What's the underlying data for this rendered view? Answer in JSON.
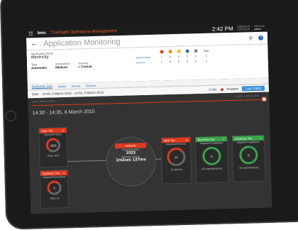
{
  "topbar": {
    "brand": "bmc",
    "app_title": "TrueSight Operations Management",
    "time": "2:42 PM",
    "date_line1": "03/06/2015",
    "date_line2": "GMT-08:00",
    "user_line1": "Welcome",
    "user_line2": "admin"
  },
  "header": {
    "title": "Application Monitoring"
  },
  "info": {
    "name_label": "Application Name",
    "name_value": "electricity",
    "type_label": "Type",
    "type_value": "Automatic",
    "importance_label": "Importance",
    "importance_value": "Medium",
    "severity_label": "Severity",
    "severity_value": "Critical",
    "total_label": "Total",
    "open_events_label": "Open Events",
    "devices_label": "Devices",
    "open_events": [
      "1",
      "0",
      "0",
      "0",
      "0",
      "1"
    ],
    "devices": [
      "1",
      "0",
      "0",
      "0",
      "0",
      "1"
    ],
    "severity_colors": [
      "#e03a1e",
      "#f08c1e",
      "#f0c01e",
      "#2a6db5",
      "#888888"
    ]
  },
  "tabs": [
    "Application View",
    "Model",
    "Events",
    "Devices"
  ],
  "datebar": {
    "date_label": "Date",
    "date_range": "14:40, 5 March 2015 - 14:55, 6 March 2015",
    "interval": "5 min",
    "problem": "Problem",
    "live_button": "Live Traffic"
  },
  "timeline": {
    "left_label": "14:40, 5 March 2015",
    "right_label": "14:55, 6 March 2015"
  },
  "range_title": "14:30 - 14:35, 6 March 2015",
  "tiers": {
    "user": {
      "title": "User Tier",
      "metric_label": "Impacted Users",
      "value": "1023",
      "total": "Total: 1672"
    },
    "synthetic": {
      "title": "Synthetic Tier",
      "metric_label": "Impacted Executions",
      "value": "3",
      "total": "Total: 14"
    },
    "network": {
      "title": "Network",
      "metric_label": "Impacted Users",
      "value": "1023",
      "latency_label": "Average latency:",
      "latency": "1m2sec 137ms"
    },
    "web": {
      "title": "Web Tier",
      "metric_label": "Impacted Servers",
      "value": "15",
      "footer": "23 Mb/Sec"
    },
    "business": {
      "title": "Business Tier",
      "metric_label": "Impacted Databases",
      "value": "8",
      "footer": "122 operations/sec"
    },
    "database": {
      "title": "Database Tier",
      "metric_label": "Impacted Databases",
      "value": "8",
      "footer": "33 operations/sec"
    }
  }
}
